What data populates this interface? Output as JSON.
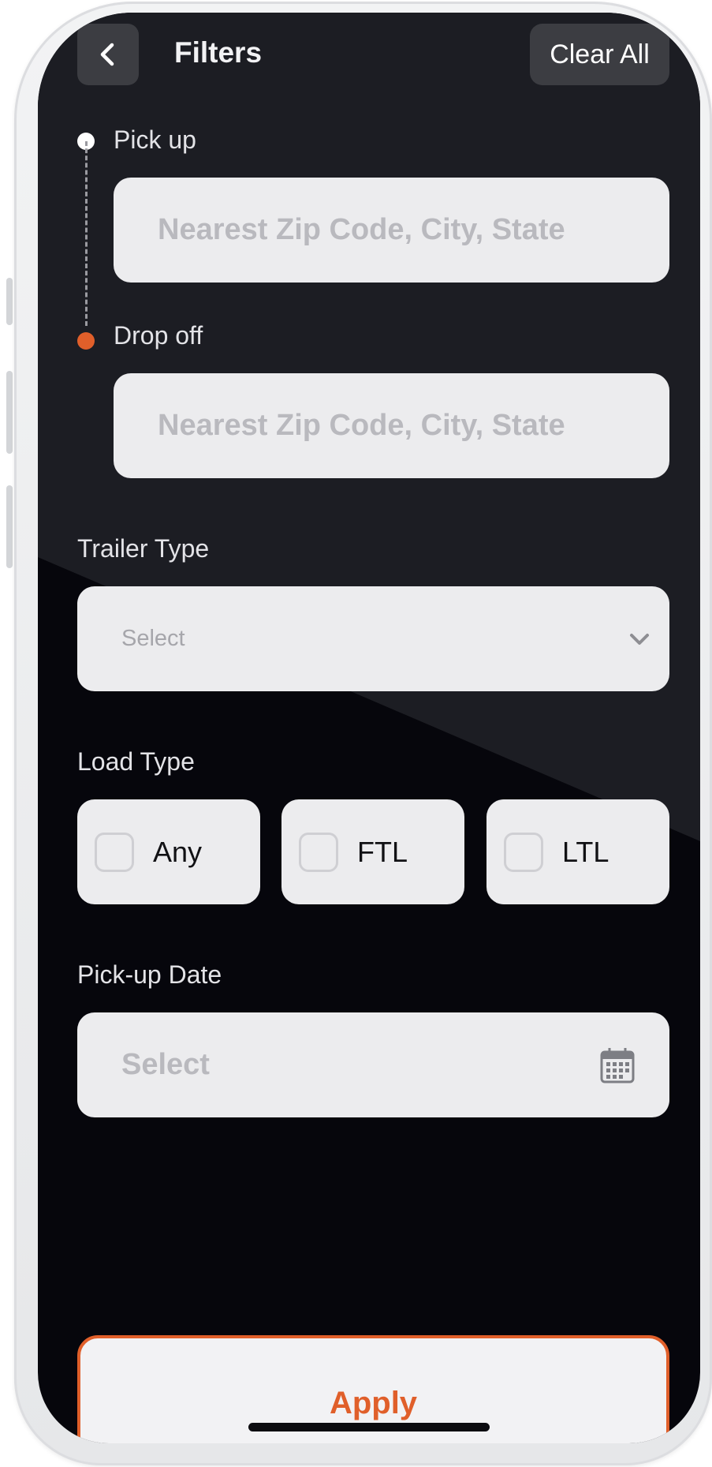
{
  "header": {
    "title": "Filters",
    "clear_all_label": "Clear All"
  },
  "route": {
    "pickup": {
      "label": "Pick up",
      "placeholder": "Nearest Zip Code, City, State"
    },
    "dropoff": {
      "label": "Drop off",
      "placeholder": "Nearest Zip Code, City, State"
    }
  },
  "trailer_type": {
    "label": "Trailer Type",
    "value": "Select"
  },
  "load_type": {
    "label": "Load Type",
    "options": [
      {
        "label": "Any",
        "checked": false
      },
      {
        "label": "FTL",
        "checked": false
      },
      {
        "label": "LTL",
        "checked": false
      }
    ]
  },
  "pickup_date": {
    "label": "Pick-up Date",
    "value": "Select"
  },
  "apply_label": "Apply",
  "colors": {
    "accent": "#E05F2A",
    "background": "#06060C",
    "field": "#ECECEE"
  },
  "icons": {
    "back": "chevron-left-icon",
    "dropdown": "chevron-down-icon",
    "date": "calendar-icon"
  }
}
